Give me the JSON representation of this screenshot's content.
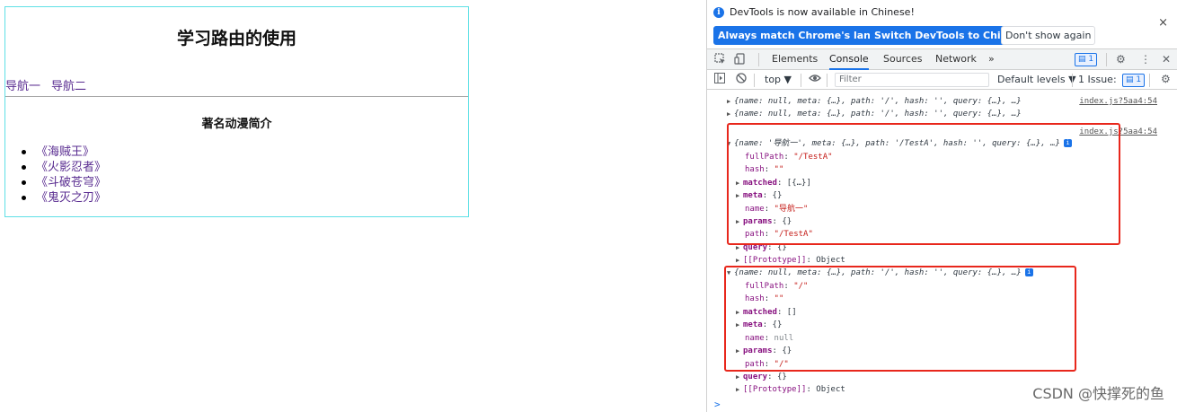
{
  "app": {
    "title": "学习路由的使用",
    "nav": [
      "导航一",
      "导航二"
    ],
    "section_title": "著名动漫简介",
    "anime": [
      "《海贼王》",
      "《火影忍者》",
      "《斗破苍穹》",
      "《鬼灭之刃》"
    ]
  },
  "devtools": {
    "info_message": "DevTools is now available in Chinese!",
    "buttons": {
      "match": "Always match Chrome's language",
      "switch": "Switch DevTools to Chinese",
      "dismiss": "Don't show again"
    },
    "close_glyph": "×",
    "tabs": [
      "Elements",
      "Console",
      "Sources",
      "Network"
    ],
    "more_tabs_glyph": "»",
    "message_badge": "1",
    "context": "top ▼",
    "filter_placeholder": "Filter",
    "levels": "Default levels ▼",
    "issues": "1 Issue:",
    "issues_count": "1",
    "prompt_glyph": ">"
  },
  "console": {
    "source": "index.js?5aa4:54",
    "route_root_summary": "{name: null, meta: {…}, path: '/', hash: '', query: {…}, …}",
    "route_a_summary": "{name: '导航一', meta: {…}, path: '/TestA', hash: '', query: {…}, …}",
    "route_a": {
      "fullPath": "\"/TestA\"",
      "hash": "\"\"",
      "matched": "[{…}]",
      "meta": "{}",
      "name": "\"导航一\"",
      "params": "{}",
      "path": "\"/TestA\"",
      "query": "{}",
      "prototype": "Object"
    },
    "route_b": {
      "fullPath": "\"/\"",
      "hash": "\"\"",
      "matched": "[]",
      "meta": "{}",
      "name": "null",
      "params": "{}",
      "path": "\"/\"",
      "query": "{}",
      "prototype": "Object"
    }
  },
  "watermark": "CSDN @快撑死的鱼"
}
